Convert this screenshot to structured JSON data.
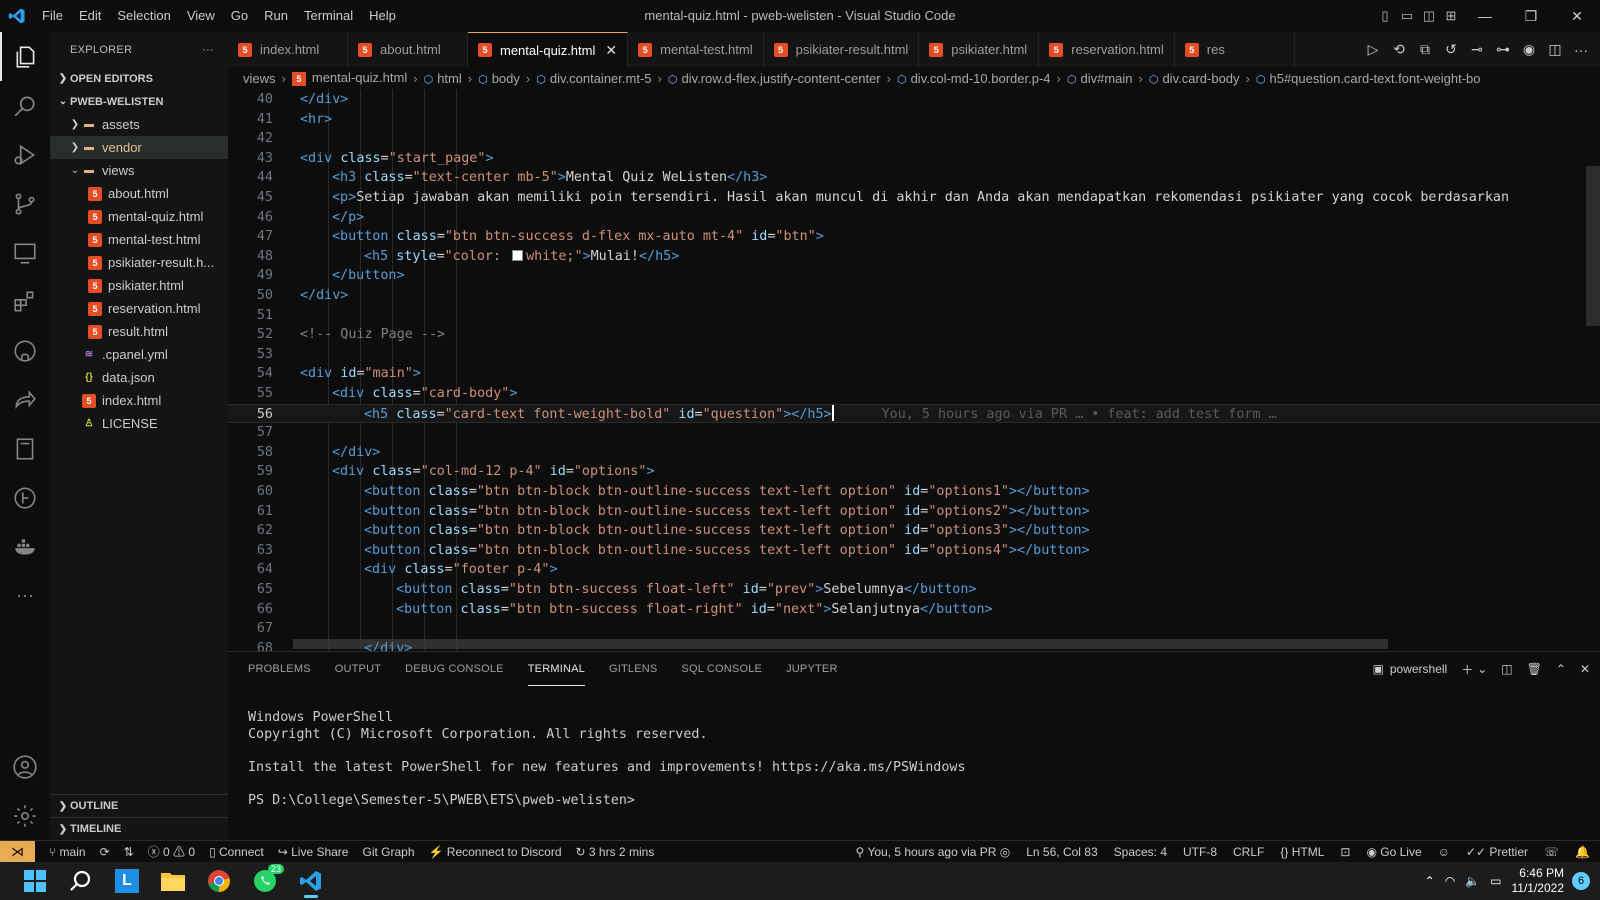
{
  "window": {
    "title": "mental-quiz.html - pweb-welisten - Visual Studio Code",
    "menu": [
      "File",
      "Edit",
      "Selection",
      "View",
      "Go",
      "Run",
      "Terminal",
      "Help"
    ]
  },
  "sidebar": {
    "header": "EXPLORER",
    "more": "···",
    "open_editors": "OPEN EDITORS",
    "project": "PWEB-WELISTEN",
    "tree": [
      {
        "label": "assets",
        "type": "folder",
        "depth": 1,
        "expanded": false
      },
      {
        "label": "vendor",
        "type": "folder",
        "depth": 1,
        "expanded": false,
        "selected": true
      },
      {
        "label": "views",
        "type": "folder",
        "depth": 1,
        "expanded": true
      },
      {
        "label": "about.html",
        "type": "html",
        "depth": 2
      },
      {
        "label": "mental-quiz.html",
        "type": "html",
        "depth": 2
      },
      {
        "label": "mental-test.html",
        "type": "html",
        "depth": 2
      },
      {
        "label": "psikiater-result.h...",
        "type": "html",
        "depth": 2
      },
      {
        "label": "psikiater.html",
        "type": "html",
        "depth": 2
      },
      {
        "label": "reservation.html",
        "type": "html",
        "depth": 2
      },
      {
        "label": "result.html",
        "type": "html",
        "depth": 2
      },
      {
        "label": ".cpanel.yml",
        "type": "yml",
        "depth": 1
      },
      {
        "label": "data.json",
        "type": "json",
        "depth": 1
      },
      {
        "label": "index.html",
        "type": "html",
        "depth": 1
      },
      {
        "label": "LICENSE",
        "type": "lic",
        "depth": 1
      }
    ],
    "outline": "OUTLINE",
    "timeline": "TIMELINE"
  },
  "tabs": [
    {
      "label": "index.html",
      "active": false
    },
    {
      "label": "about.html",
      "active": false
    },
    {
      "label": "mental-quiz.html",
      "active": true
    },
    {
      "label": "mental-test.html",
      "active": false
    },
    {
      "label": "psikiater-result.html",
      "active": false
    },
    {
      "label": "psikiater.html",
      "active": false
    },
    {
      "label": "reservation.html",
      "active": false
    },
    {
      "label": "res",
      "active": false
    }
  ],
  "breadcrumb": [
    "views",
    "mental-quiz.html",
    "html",
    "body",
    "div.container.mt-5",
    "div.row.d-flex.justify-content-center",
    "div.col-md-10.border.p-4",
    "div#main",
    "div.card-body",
    "h5#question.card-text.font-weight-bo"
  ],
  "editor": {
    "current_line": 56,
    "blame": "You, 5 hours ago via PR … • feat: add test form …",
    "lines": [
      {
        "n": 40,
        "i": 4,
        "t": [
          [
            "tg",
            "</div>"
          ]
        ]
      },
      {
        "n": 41,
        "i": 4,
        "t": [
          [
            "tg",
            "<hr>"
          ]
        ]
      },
      {
        "n": 42,
        "i": 0,
        "t": []
      },
      {
        "n": 43,
        "i": 4,
        "t": [
          [
            "tg",
            "<div "
          ],
          [
            "an",
            "class"
          ],
          [
            "tx",
            "="
          ],
          [
            "av",
            "\"start_page\""
          ],
          [
            "tg",
            ">"
          ]
        ]
      },
      {
        "n": 44,
        "i": 5,
        "t": [
          [
            "tg",
            "<h3 "
          ],
          [
            "an",
            "class"
          ],
          [
            "tx",
            "="
          ],
          [
            "av",
            "\"text-center mb-5\""
          ],
          [
            "tg",
            ">"
          ],
          [
            "tx",
            "Mental Quiz WeListen"
          ],
          [
            "tg",
            "</h3>"
          ]
        ]
      },
      {
        "n": 45,
        "i": 5,
        "t": [
          [
            "tg",
            "<p>"
          ],
          [
            "tx",
            "Setiap jawaban akan memiliki poin tersendiri. Hasil akan muncul di akhir dan Anda akan mendapatkan rekomendasi psikiater yang cocok berdasarkan"
          ]
        ]
      },
      {
        "n": 46,
        "i": 5,
        "t": [
          [
            "tg",
            "</p>"
          ]
        ]
      },
      {
        "n": 47,
        "i": 5,
        "t": [
          [
            "tg",
            "<button "
          ],
          [
            "an",
            "class"
          ],
          [
            "tx",
            "="
          ],
          [
            "av",
            "\"btn btn-success d-flex mx-auto mt-4\""
          ],
          [
            "tx",
            " "
          ],
          [
            "an",
            "id"
          ],
          [
            "tx",
            "="
          ],
          [
            "av",
            "\"btn\""
          ],
          [
            "tg",
            ">"
          ]
        ]
      },
      {
        "n": 48,
        "i": 6,
        "t": [
          [
            "tg",
            "<h5 "
          ],
          [
            "an",
            "style"
          ],
          [
            "tx",
            "="
          ],
          [
            "av",
            "\"color: "
          ],
          [
            "sw",
            ""
          ],
          [
            "av",
            "white;\""
          ],
          [
            "tg",
            ">"
          ],
          [
            "tx",
            "Mulai!"
          ],
          [
            "tg",
            "</h5>"
          ]
        ]
      },
      {
        "n": 49,
        "i": 5,
        "t": [
          [
            "tg",
            "</button>"
          ]
        ]
      },
      {
        "n": 50,
        "i": 4,
        "t": [
          [
            "tg",
            "</div>"
          ]
        ]
      },
      {
        "n": 51,
        "i": 0,
        "t": []
      },
      {
        "n": 52,
        "i": 4,
        "t": [
          [
            "bl",
            "<!-- Quiz Page -->"
          ]
        ]
      },
      {
        "n": 53,
        "i": 0,
        "t": []
      },
      {
        "n": 54,
        "i": 4,
        "t": [
          [
            "tg",
            "<div "
          ],
          [
            "an",
            "id"
          ],
          [
            "tx",
            "="
          ],
          [
            "av",
            "\"main\""
          ],
          [
            "tg",
            ">"
          ]
        ]
      },
      {
        "n": 55,
        "i": 5,
        "t": [
          [
            "tg",
            "<div "
          ],
          [
            "an",
            "class"
          ],
          [
            "tx",
            "="
          ],
          [
            "av",
            "\"card-body\""
          ],
          [
            "tg",
            ">"
          ]
        ]
      },
      {
        "n": 56,
        "i": 6,
        "t": [
          [
            "tg",
            "<h5 "
          ],
          [
            "an",
            "class"
          ],
          [
            "tx",
            "="
          ],
          [
            "av",
            "\"card-text font-weight-bold\""
          ],
          [
            "tx",
            " "
          ],
          [
            "an",
            "id"
          ],
          [
            "tx",
            "="
          ],
          [
            "av",
            "\"question\""
          ],
          [
            "tg",
            "></h5>"
          ]
        ]
      },
      {
        "n": 57,
        "i": 0,
        "t": []
      },
      {
        "n": 58,
        "i": 5,
        "t": [
          [
            "tg",
            "</div>"
          ]
        ]
      },
      {
        "n": 59,
        "i": 5,
        "t": [
          [
            "tg",
            "<div "
          ],
          [
            "an",
            "class"
          ],
          [
            "tx",
            "="
          ],
          [
            "av",
            "\"col-md-12 p-4\""
          ],
          [
            "tx",
            " "
          ],
          [
            "an",
            "id"
          ],
          [
            "tx",
            "="
          ],
          [
            "av",
            "\"options\""
          ],
          [
            "tg",
            ">"
          ]
        ]
      },
      {
        "n": 60,
        "i": 6,
        "t": [
          [
            "tg",
            "<button "
          ],
          [
            "an",
            "class"
          ],
          [
            "tx",
            "="
          ],
          [
            "av",
            "\"btn btn-block btn-outline-success text-left option\""
          ],
          [
            "tx",
            " "
          ],
          [
            "an",
            "id"
          ],
          [
            "tx",
            "="
          ],
          [
            "av",
            "\"options1\""
          ],
          [
            "tg",
            "></button>"
          ]
        ]
      },
      {
        "n": 61,
        "i": 6,
        "t": [
          [
            "tg",
            "<button "
          ],
          [
            "an",
            "class"
          ],
          [
            "tx",
            "="
          ],
          [
            "av",
            "\"btn btn-block btn-outline-success text-left option\""
          ],
          [
            "tx",
            " "
          ],
          [
            "an",
            "id"
          ],
          [
            "tx",
            "="
          ],
          [
            "av",
            "\"options2\""
          ],
          [
            "tg",
            "></button>"
          ]
        ]
      },
      {
        "n": 62,
        "i": 6,
        "t": [
          [
            "tg",
            "<button "
          ],
          [
            "an",
            "class"
          ],
          [
            "tx",
            "="
          ],
          [
            "av",
            "\"btn btn-block btn-outline-success text-left option\""
          ],
          [
            "tx",
            " "
          ],
          [
            "an",
            "id"
          ],
          [
            "tx",
            "="
          ],
          [
            "av",
            "\"options3\""
          ],
          [
            "tg",
            "></button>"
          ]
        ]
      },
      {
        "n": 63,
        "i": 6,
        "t": [
          [
            "tg",
            "<button "
          ],
          [
            "an",
            "class"
          ],
          [
            "tx",
            "="
          ],
          [
            "av",
            "\"btn btn-block btn-outline-success text-left option\""
          ],
          [
            "tx",
            " "
          ],
          [
            "an",
            "id"
          ],
          [
            "tx",
            "="
          ],
          [
            "av",
            "\"options4\""
          ],
          [
            "tg",
            "></button>"
          ]
        ]
      },
      {
        "n": 64,
        "i": 6,
        "t": [
          [
            "tg",
            "<div "
          ],
          [
            "an",
            "class"
          ],
          [
            "tx",
            "="
          ],
          [
            "av",
            "\"footer p-4\""
          ],
          [
            "tg",
            ">"
          ]
        ]
      },
      {
        "n": 65,
        "i": 7,
        "t": [
          [
            "tg",
            "<button "
          ],
          [
            "an",
            "class"
          ],
          [
            "tx",
            "="
          ],
          [
            "av",
            "\"btn btn-success float-left\""
          ],
          [
            "tx",
            " "
          ],
          [
            "an",
            "id"
          ],
          [
            "tx",
            "="
          ],
          [
            "av",
            "\"prev\""
          ],
          [
            "tg",
            ">"
          ],
          [
            "tx",
            "Sebelumnya"
          ],
          [
            "tg",
            "</button>"
          ]
        ]
      },
      {
        "n": 66,
        "i": 7,
        "t": [
          [
            "tg",
            "<button "
          ],
          [
            "an",
            "class"
          ],
          [
            "tx",
            "="
          ],
          [
            "av",
            "\"btn btn-success float-right\""
          ],
          [
            "tx",
            " "
          ],
          [
            "an",
            "id"
          ],
          [
            "tx",
            "="
          ],
          [
            "av",
            "\"next\""
          ],
          [
            "tg",
            ">"
          ],
          [
            "tx",
            "Selanjutnya"
          ],
          [
            "tg",
            "</button>"
          ]
        ]
      },
      {
        "n": 67,
        "i": 0,
        "t": []
      },
      {
        "n": 68,
        "i": 6,
        "t": [
          [
            "tg",
            "</div>"
          ]
        ]
      }
    ]
  },
  "panel": {
    "tabs": [
      "PROBLEMS",
      "OUTPUT",
      "DEBUG CONSOLE",
      "TERMINAL",
      "GITLENS",
      "SQL CONSOLE",
      "JUPYTER"
    ],
    "active_tab": "TERMINAL",
    "shell": "powershell",
    "terminal_lines": [
      "Windows PowerShell",
      "Copyright (C) Microsoft Corporation. All rights reserved.",
      "",
      "Install the latest PowerShell for new features and improvements! https://aka.ms/PSWindows",
      "",
      "PS D:\\College\\Semester-5\\PWEB\\ETS\\pweb-welisten>"
    ]
  },
  "status": {
    "branch": "main",
    "errors": "0",
    "warnings": "0",
    "connect": "Connect",
    "live_share": "Live Share",
    "git_graph": "Git Graph",
    "discord": "Reconnect to Discord",
    "timer": "3 hrs 2 mins",
    "blame": "You, 5 hours ago via PR",
    "position": "Ln 56, Col 83",
    "spaces": "Spaces: 4",
    "encoding": "UTF-8",
    "eol": "CRLF",
    "language": "HTML",
    "go_live": "Go Live",
    "prettier": "Prettier"
  },
  "taskbar": {
    "time": "6:46 PM",
    "date": "11/1/2022",
    "whatsapp_badge": "23",
    "notifications": "6"
  },
  "colors": {
    "accent": "#e8ab53",
    "html_icon": "#e44d26",
    "folder": "#dcb67a"
  }
}
